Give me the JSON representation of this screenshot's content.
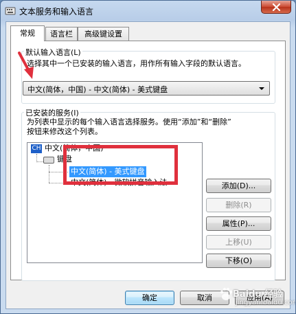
{
  "window": {
    "title": "文本服务和输入语言",
    "close_icon": "close-icon"
  },
  "tabs": [
    {
      "label": "常规",
      "active": true
    },
    {
      "label": "语言栏",
      "active": false
    },
    {
      "label": "高级键设置",
      "active": false
    }
  ],
  "default_language": {
    "group_label": "默认输入语言(L)",
    "description": "选择其中一个已安装的输入语言，用作所有输入字段的默认语言。",
    "selected": "中文(简体，中国) - 中文(简体) - 美式键盘"
  },
  "installed_services": {
    "group_label": "已安装的服务(I)",
    "description_line1": "为列表中显示的每个输入语言选择服务。使用“添加”和“删除”",
    "description_line2": "按钮来修改这个列表。",
    "tree": {
      "language_badge": "CH",
      "language": "中文(简体，中国)",
      "category": "键盘",
      "items": [
        {
          "label": "中文(简体) - 美式键盘",
          "selected": true
        },
        {
          "label": "中文(简体) - 微软拼音输入法",
          "selected": false
        }
      ]
    },
    "buttons": {
      "add": "添加(D)...",
      "remove": "删除(R)",
      "properties": "属性(P)...",
      "move_up": "上移(U)",
      "move_down": "下移(O)"
    }
  },
  "footer": {
    "ok": "确定",
    "cancel": "取消",
    "apply": "应用(A)"
  },
  "watermark": {
    "brand": "Baidu 经验",
    "url": "jingyan.baidu.com"
  },
  "colors": {
    "highlight": "#3399ff",
    "annotation_red": "#e0303d"
  }
}
